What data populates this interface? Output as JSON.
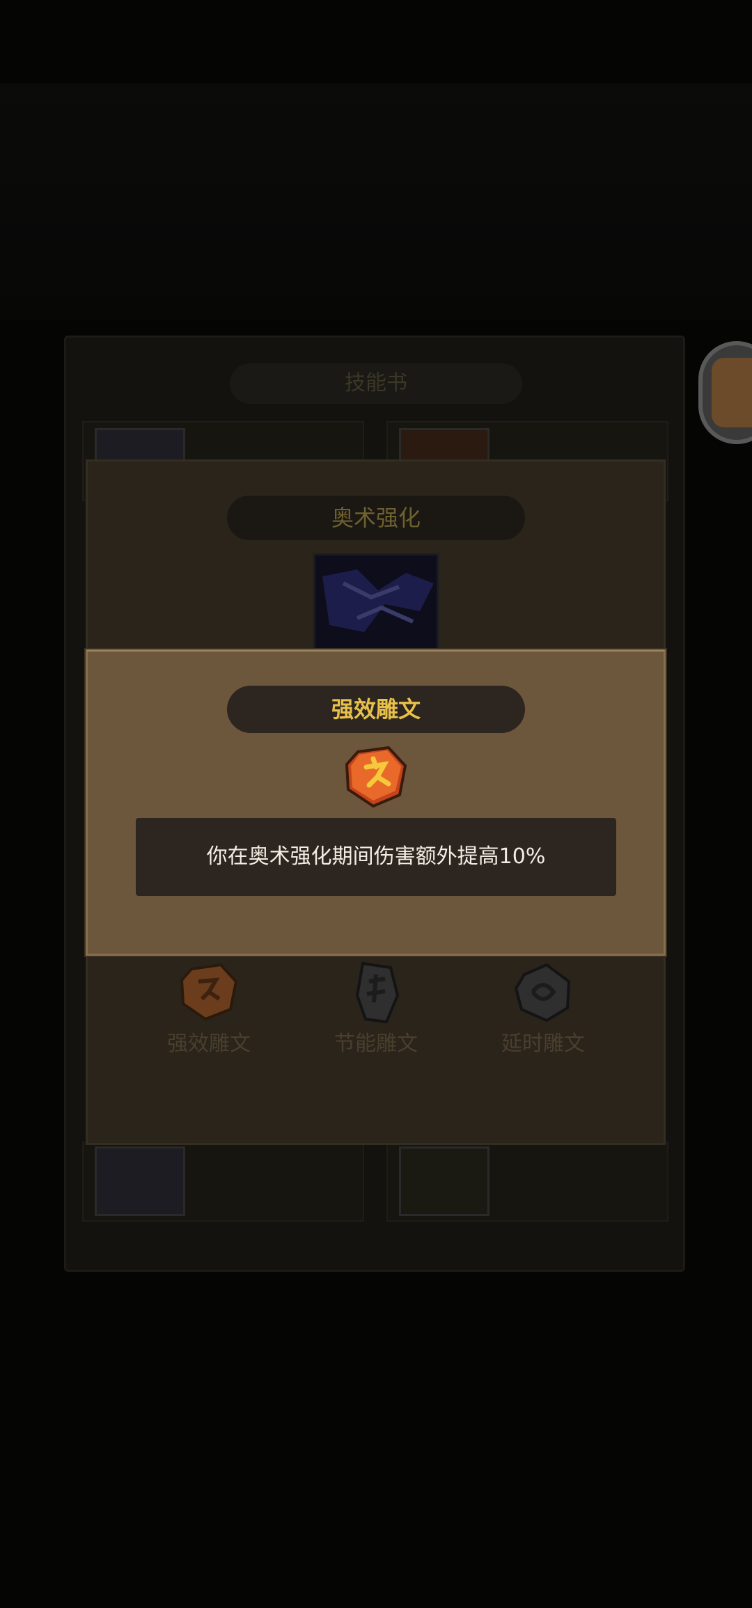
{
  "background": {
    "skillbook_title": "技能书"
  },
  "arcane_dialog": {
    "title": "奥术强化",
    "runes": [
      {
        "label": "强效雕文",
        "color": "#6b3d1c"
      },
      {
        "label": "节能雕文",
        "color": "#2f2f2f"
      },
      {
        "label": "延时雕文",
        "color": "#2f2f2f"
      }
    ]
  },
  "rune_dialog": {
    "title": "强效雕文",
    "description": "你在奥术强化期间伤害额外提高10%",
    "icon": "flaming-rune-icon"
  },
  "colors": {
    "accent_gold": "#e8c14a",
    "panel_brown": "#6d573c",
    "dark_box": "#2d2620"
  }
}
